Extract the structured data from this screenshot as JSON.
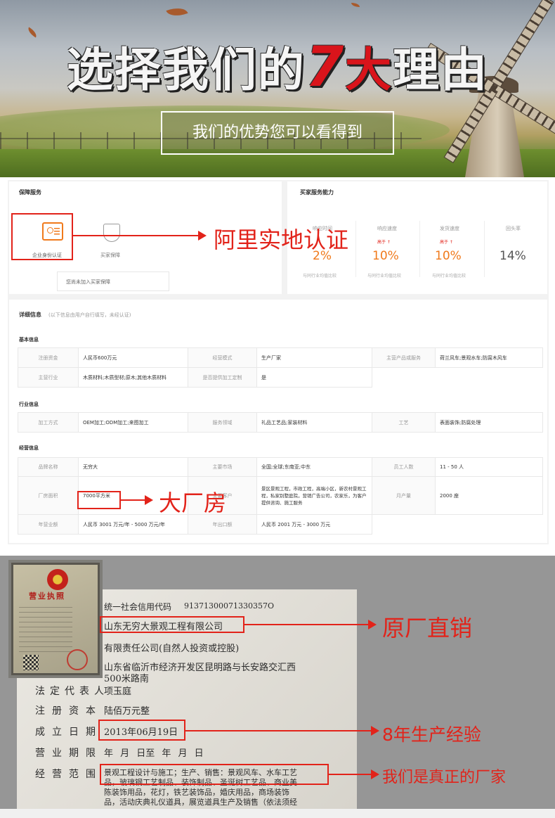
{
  "hero": {
    "title_a": "选择我们的",
    "title_num": "7",
    "title_big": "大",
    "title_b": "理由",
    "subtitle": "我们的优势您可以看得到"
  },
  "guarantee": {
    "title": "保障服务",
    "items": [
      {
        "label": "企业身份认证",
        "icon": "id-card-icon"
      },
      {
        "label": "买家保障",
        "icon": "shield-icon"
      }
    ],
    "note": "您尚未加入买家保障"
  },
  "buyer_service": {
    "title": "买家服务能力",
    "metrics": [
      {
        "label": "响应时间",
        "badge": "",
        "value": "2%",
        "compare": "与同行业均值比较"
      },
      {
        "label": "响应速度",
        "badge": "高于 ↑",
        "value": "10%",
        "compare": "与同行业均值比较"
      },
      {
        "label": "发货速度",
        "badge": "高于 ↑",
        "value": "10%",
        "compare": "与同行业均值比较"
      },
      {
        "label": "回头率",
        "badge": "",
        "value": "14%",
        "compare": ""
      }
    ]
  },
  "details": {
    "title": "详细信息",
    "note": "(以下信息由用户自行填写，未经认证)",
    "basic": {
      "label": "基本信息",
      "rows": [
        [
          "注册资金",
          "人民币600万元",
          "经营模式",
          "生产厂家",
          "主营产品或服务",
          "荷兰风车;景观水车;防腐木风车"
        ],
        [
          "主营行业",
          "木质材料;木质型材;原木;其他木质材料",
          "是否提供加工定制",
          "是",
          "",
          ""
        ]
      ]
    },
    "industry": {
      "label": "行业信息",
      "rows": [
        [
          "加工方式",
          "OEM加工;ODM加工;来图加工",
          "服务领域",
          "礼品工艺品;家装材料",
          "工艺",
          "表面装饰;防腐处理"
        ]
      ]
    },
    "business": {
      "label": "经营信息",
      "rows": [
        [
          "品牌名称",
          "无穷大",
          "主要市场",
          "全国;全球;东南亚;中东",
          "员工人数",
          "11 - 50 人"
        ],
        [
          "厂房面积",
          "7000平方米",
          "主要客户",
          "景区景观工程，市政工程，高端小区，新农村景观工程，私家别墅庭院，营销广告公司，农家乐，为客户提供咨询、施工服务",
          "月产量",
          "2000 座"
        ],
        [
          "年营业额",
          "人民币 3001 万元/年 - 5000 万元/年",
          "年出口额",
          "人民币 2001 万元 - 3000 万元",
          "",
          ""
        ]
      ]
    }
  },
  "annotations": {
    "ali": "阿里实地认证",
    "factory": "大厂房",
    "direct": "原厂直销",
    "experience": "8年生产经验",
    "real": "我们是真正的厂家"
  },
  "license": {
    "thumb_title": "营业执照",
    "credit_code_label": "统一社会信用代码",
    "credit_code": "91371300071330357O",
    "company_name": "山东无穷大景观工程有限公司",
    "company_type": "有限责任公司(自然人投资或控股)",
    "address_1": "山东省临沂市经济开发区昆明路与长安路交汇西",
    "address_2": "500米路南",
    "rep_label": "法定代表人",
    "rep": "项玉庭",
    "capital_label": "注册资本",
    "capital": "陆佰万元整",
    "date_label": "成立日期",
    "date": "2013年06月19日",
    "term_label": "营业期限",
    "term": "年  月  日至    年  月  日",
    "scope_label": "经营范围",
    "scope_1": "景观工程设计与施工；生产、销售：景观风车、水车工艺",
    "scope_2": "品，玻璃钢工艺制品、装饰制品、圣诞树工艺品、商业美",
    "scope_3": "陈装饰用品，花灯，铁艺装饰品，婚庆用品，商场装饰",
    "scope_4": "品，活动庆典礼仪道具，展览道具生产及销售（依法须经"
  }
}
